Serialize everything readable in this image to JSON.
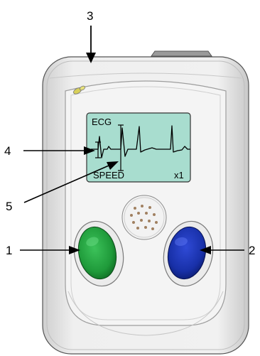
{
  "device": {
    "screen": {
      "mode_label": "ECG",
      "speed_label": "SPEED",
      "speed_value": "x1"
    },
    "left_button_color": "#1f9a3a",
    "right_button_color": "#1830a8",
    "screen_color": "#a8ddcf",
    "body_color": "#e9e9e9"
  },
  "callouts": {
    "c1": "1",
    "c2": "2",
    "c3": "3",
    "c4": "4",
    "c5": "5"
  }
}
